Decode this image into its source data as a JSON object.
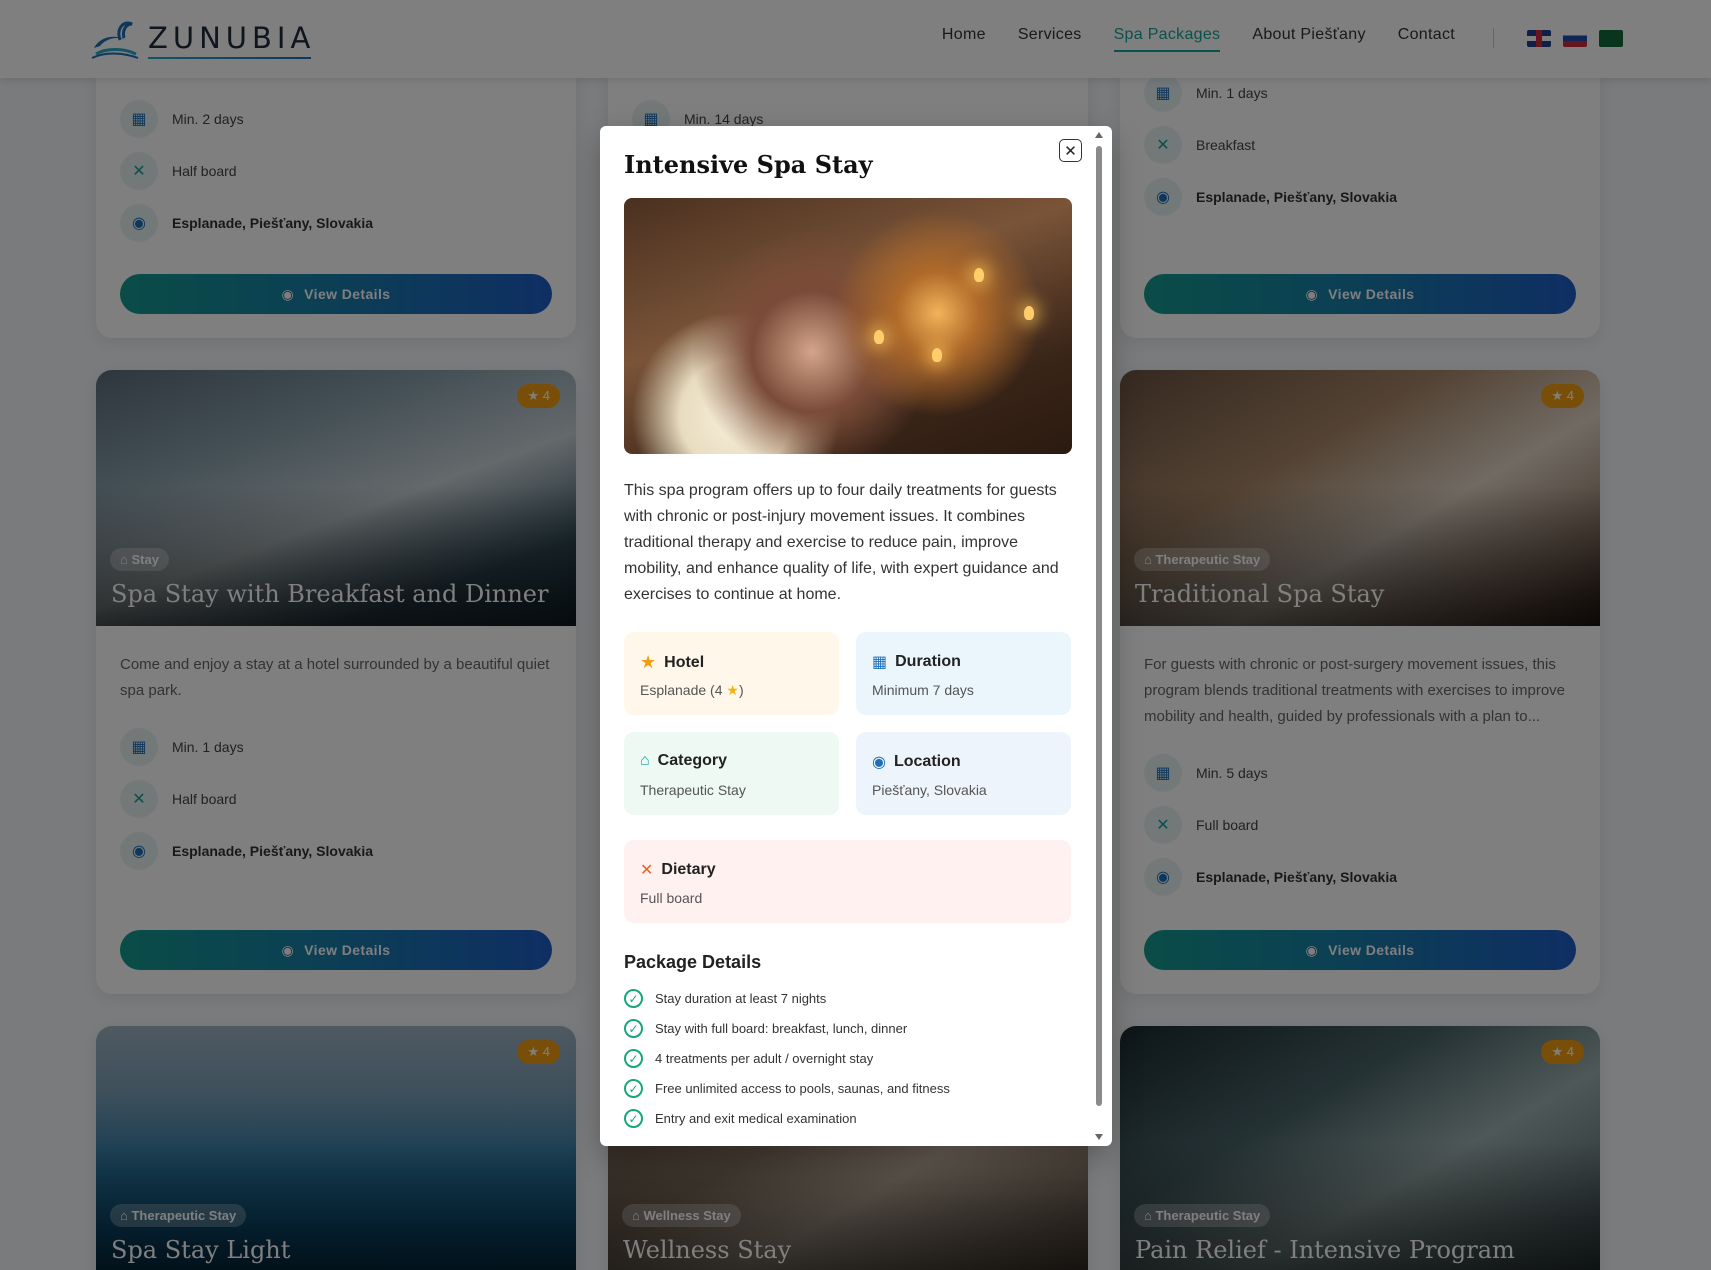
{
  "header": {
    "brand": "ZUNUBIA",
    "nav": [
      "Home",
      "Services",
      "Spa Packages",
      "About Piešťany",
      "Contact"
    ],
    "active_nav": "Spa Packages",
    "languages": [
      "English",
      "Slovak",
      "Arabic"
    ]
  },
  "cards": {
    "c1": {
      "duration": "Min. 2 days",
      "board": "Half board",
      "location": "Esplanade, Piešťany, Slovakia",
      "button": "View Details"
    },
    "c2": {
      "duration": "Min. 14 days"
    },
    "c3": {
      "duration": "Min. 1 days",
      "board": "Breakfast",
      "location": "Esplanade, Piešťany, Slovakia",
      "button": "View Details"
    },
    "c4": {
      "rating": "4",
      "tag": "Stay",
      "title": "Spa Stay with Breakfast and Dinner",
      "desc": "Come and enjoy a stay at a hotel surrounded by a beautiful quiet spa park.",
      "duration": "Min. 1 days",
      "board": "Half board",
      "location": "Esplanade, Piešťany, Slovakia",
      "button": "View Details"
    },
    "c6": {
      "rating": "4",
      "tag": "Therapeutic Stay",
      "title": "Traditional Spa Stay",
      "desc": "For guests with chronic or post-surgery movement issues, this program blends traditional treatments with exercises to improve mobility and health, guided by professionals with a plan to...",
      "duration": "Min. 5 days",
      "board": "Full board",
      "location": "Esplanade, Piešťany, Slovakia",
      "button": "View Details"
    },
    "c7": {
      "rating": "4",
      "tag": "Therapeutic Stay",
      "title": "Spa Stay Light"
    },
    "c8": {
      "tag": "Wellness Stay",
      "title": "Wellness Stay"
    },
    "c9": {
      "rating": "4",
      "tag": "Therapeutic Stay",
      "title": "Pain Relief - Intensive Program"
    }
  },
  "modal": {
    "title": "Intensive Spa Stay",
    "description": "This spa program offers up to four daily treatments for guests with chronic or post-injury movement issues. It combines traditional therapy and exercise to reduce pain, improve mobility, and enhance quality of life, with expert guidance and exercises to continue at home.",
    "hotel_label": "Hotel",
    "hotel_value": "Esplanade (4",
    "hotel_value_end": ")",
    "duration_label": "Duration",
    "duration_value": "Minimum 7 days",
    "category_label": "Category",
    "category_value": "Therapeutic Stay",
    "location_label": "Location",
    "location_value": "Piešťany, Slovakia",
    "dietary_label": "Dietary",
    "dietary_value": "Full board",
    "package_title": "Package Details",
    "package_items": [
      "Stay duration at least 7 nights",
      "Stay with full board: breakfast, lunch, dinner",
      "4 treatments per adult / overnight stay",
      "Free unlimited access to pools, saunas, and fitness",
      "Entry and exit medical examination"
    ]
  },
  "colors": {
    "accent": "#15a39a",
    "button_from": "#139a8f",
    "button_to": "#1e5ec6",
    "rating": "#f29c11"
  }
}
